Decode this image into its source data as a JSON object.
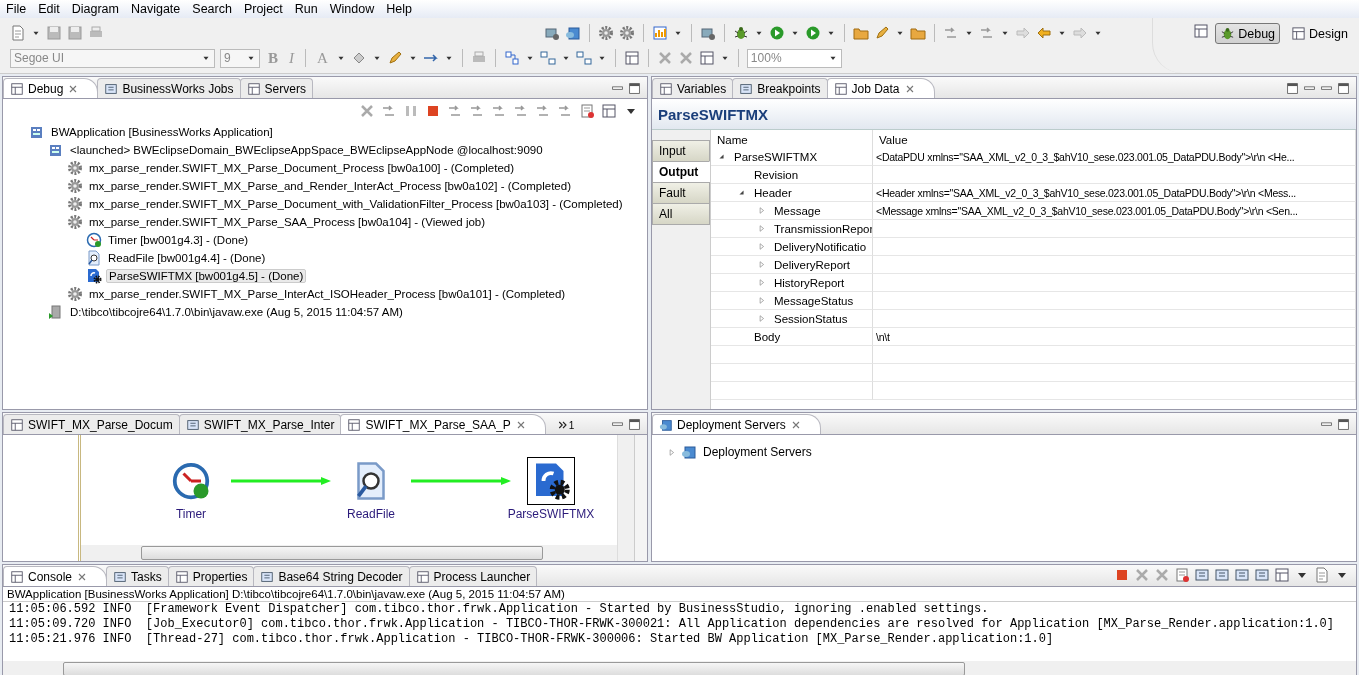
{
  "menu": [
    "File",
    "Edit",
    "Diagram",
    "Navigate",
    "Search",
    "Project",
    "Run",
    "Window",
    "Help"
  ],
  "toolbar": {
    "font_field": "Segoe UI",
    "size_field": "9",
    "bold_label": "B",
    "italic_label": "I",
    "font_color_label": "A",
    "zoom_field": "100%",
    "perspectives": [
      {
        "label": "Debug",
        "selected": true
      },
      {
        "label": "Design",
        "selected": false
      }
    ]
  },
  "debug_view": {
    "tabs": [
      {
        "label": "Debug",
        "selected": true
      },
      {
        "label": "BusinessWorks Jobs",
        "selected": false
      },
      {
        "label": "Servers",
        "selected": false
      }
    ],
    "tree": [
      {
        "label": "BWApplication [BusinessWorks Application]",
        "kind": "app",
        "selected": false,
        "children": [
          {
            "label": "<launched> BWEclipseDomain_BWEclipseAppSpace_BWEclipseAppNode @localhost:9090",
            "kind": "app",
            "selected": false,
            "children": [
              {
                "label": "mx_parse_render.SWIFT_MX_Parse_Document_Process [bw0a100] - (Completed)",
                "kind": "process",
                "selected": false
              },
              {
                "label": "mx_parse_render.SWIFT_MX_Parse_and_Render_InterAct_Process [bw0a102] - (Completed)",
                "kind": "process",
                "selected": false
              },
              {
                "label": "mx_parse_render.SWIFT_MX_Parse_Document_with_ValidationFilter_Process [bw0a103] - (Completed)",
                "kind": "process",
                "selected": false
              },
              {
                "label": "mx_parse_render.SWIFT_MX_Parse_SAA_Process [bw0a104] - (Viewed job)",
                "kind": "process",
                "selected": false,
                "children": [
                  {
                    "label": "Timer [bw001g4.3] - (Done)",
                    "kind": "timer",
                    "selected": false
                  },
                  {
                    "label": "ReadFile [bw001g4.4] - (Done)",
                    "kind": "readfile",
                    "selected": false
                  },
                  {
                    "label": "ParseSWIFTMX [bw001g4.5] - (Done)",
                    "kind": "parse",
                    "selected": true
                  }
                ]
              },
              {
                "label": "mx_parse_render.SWIFT_MX_Parse_InterAct_ISOHeader_Process [bw0a101] - (Completed)",
                "kind": "process",
                "selected": false
              }
            ]
          },
          {
            "label": "D:\\tibco\\tibcojre64\\1.7.0\\bin\\javaw.exe (Aug 5, 2015 11:04:57 AM)",
            "kind": "jvm",
            "selected": false
          }
        ]
      }
    ]
  },
  "job_view": {
    "tabs": [
      {
        "label": "Variables",
        "selected": false
      },
      {
        "label": "Breakpoints",
        "selected": false
      },
      {
        "label": "Job Data",
        "selected": true
      }
    ],
    "title": "ParseSWIFTMX",
    "side_tabs": [
      {
        "label": "Input",
        "selected": false
      },
      {
        "label": "Output",
        "selected": true
      },
      {
        "label": "Fault",
        "selected": false
      },
      {
        "label": "All",
        "selected": false
      }
    ],
    "columns": [
      "Name",
      "Value"
    ],
    "rows": [
      {
        "name": "ParseSWIFTMX",
        "value": "<DataPDU xmlns=\"SAA_XML_v2_0_3_$ahV10_sese.023.001.05_DataPDU.Body\">\\r\\n  <He...",
        "expanded": true,
        "children": [
          {
            "name": "Revision"
          },
          {
            "name": "Header",
            "value": "<Header xmlns=\"SAA_XML_v2_0_3_$ahV10_sese.023.001.05_DataPDU.Body\">\\r\\n  <Mess...",
            "expanded": true,
            "children": [
              {
                "name": "Message",
                "value": "<Message xmlns=\"SAA_XML_v2_0_3_$ahV10_sese.023.001.05_DataPDU.Body\">\\r\\n  <Sen...",
                "expanded": false
              },
              {
                "name": "TransmissionRepor",
                "expanded": false
              },
              {
                "name": "DeliveryNotificatio",
                "expanded": false
              },
              {
                "name": "DeliveryReport",
                "expanded": false
              },
              {
                "name": "HistoryReport",
                "expanded": false
              },
              {
                "name": "MessageStatus",
                "expanded": false
              },
              {
                "name": "SessionStatus",
                "expanded": false
              }
            ]
          },
          {
            "name": "Body",
            "value": "\\n\\t"
          }
        ]
      }
    ]
  },
  "editor": {
    "tabs": [
      {
        "label": "SWIFT_MX_Parse_Docum",
        "selected": false
      },
      {
        "label": "SWIFT_MX_Parse_Inter",
        "selected": false
      },
      {
        "label": "SWIFT_MX_Parse_SAA_P",
        "selected": true
      }
    ],
    "overflow_count": "1",
    "nodes": [
      {
        "label": "Timer",
        "kind": "timer",
        "selected": false
      },
      {
        "label": "ReadFile",
        "kind": "readfile",
        "selected": false
      },
      {
        "label": "ParseSWIFTMX",
        "kind": "parse",
        "selected": true
      }
    ]
  },
  "deployment_view": {
    "tabs": [
      {
        "label": "Deployment Servers",
        "selected": true
      }
    ],
    "tree": [
      {
        "label": "Deployment Servers",
        "expanded": false
      }
    ]
  },
  "console": {
    "tabs": [
      {
        "label": "Console",
        "selected": true
      },
      {
        "label": "Tasks",
        "selected": false
      },
      {
        "label": "Properties",
        "selected": false
      },
      {
        "label": "Base64 String Decoder",
        "selected": false
      },
      {
        "label": "Process Launcher",
        "selected": false
      }
    ],
    "header": "BWApplication [BusinessWorks Application] D:\\tibco\\tibcojre64\\1.7.0\\bin\\javaw.exe (Aug 5, 2015 11:04:57 AM)",
    "lines": [
      "11:05:06.592 INFO  [Framework Event Dispatcher] com.tibco.thor.frwk.Application - Started by BusinessStudio, ignoring .enabled settings.",
      "11:05:09.720 INFO  [Job_Executor0] com.tibco.thor.frwk.Application - TIBCO-THOR-FRWK-300021: All Application dependencies are resolved for Application [MX_Parse_Render.application:1.0]",
      "11:05:21.976 INFO  [Thread-27] com.tibco.thor.frwk.Application - TIBCO-THOR-FRWK-300006: Started BW Application [MX_Parse_Render.application:1.0]"
    ]
  }
}
